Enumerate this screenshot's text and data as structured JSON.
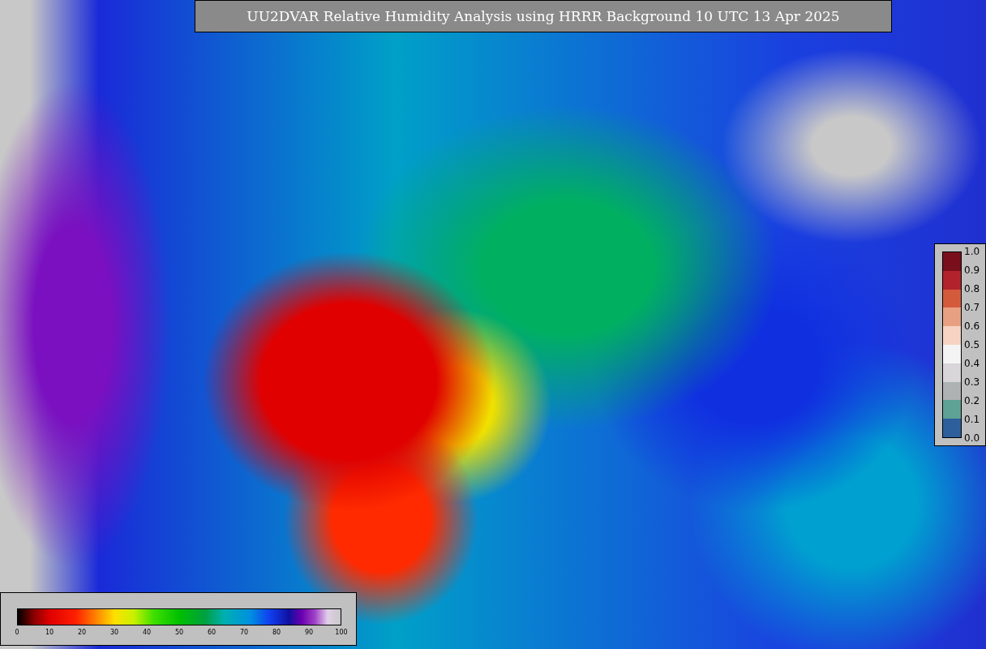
{
  "title": "UU2DVAR Relative Humidity Analysis using HRRR Background 10 UTC 13 Apr 2025",
  "obs_legend": {
    "ticks": [
      "1.0",
      "0.9",
      "0.8",
      "0.7",
      "0.6",
      "0.5",
      "0.4",
      "0.3",
      "0.2",
      "0.1",
      "0.0"
    ],
    "bins": [
      {
        "color": "#7a0f1c"
      },
      {
        "color": "#b2222d"
      },
      {
        "color": "#d45a3c"
      },
      {
        "color": "#e8a083"
      },
      {
        "color": "#f6d3c2"
      },
      {
        "color": "#f4f4f4"
      },
      {
        "color": "#d8d6d8"
      },
      {
        "color": "#aeb2b2"
      },
      {
        "color": "#5ea296"
      },
      {
        "color": "#2c5f9c"
      }
    ]
  },
  "humidity_legend": {
    "ticks": [
      "0",
      "10",
      "20",
      "30",
      "40",
      "50",
      "60",
      "70",
      "80",
      "90",
      "100"
    ]
  }
}
